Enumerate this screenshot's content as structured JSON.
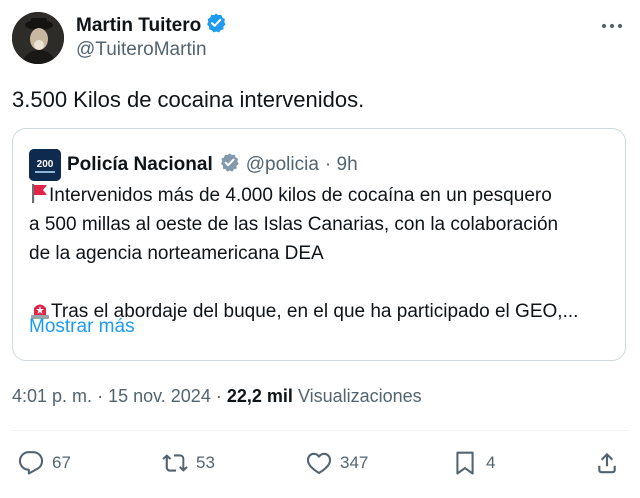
{
  "author": {
    "name": "Martin Tuitero",
    "handle": "@TuiteroMartin",
    "verified_color": "#1d9bf0"
  },
  "tweet": {
    "text": "3.500 Kilos de cocaina intervenidos."
  },
  "quoted": {
    "name": "Policía Nacional",
    "handle": "@policia",
    "time": "· 9h",
    "logo_text": "200",
    "lines": [
      "Intervenidos más de 4.000 kilos de cocaína en un pesquero",
      "a 500 millas al oeste de las Islas Canarias, con la colaboración",
      "de la agencia norteamericana DEA"
    ],
    "line4": "Tras el abordaje del buque, en el que ha participado el GEO,...",
    "show_more": "Mostrar más"
  },
  "meta": {
    "time": "4:01 p. m.",
    "dot1": "·",
    "date": "15 nov. 2024",
    "dot2": "·",
    "views_count": "22,2 mil",
    "views_label": "Visualizaciones"
  },
  "actions": {
    "replies": "67",
    "reposts": "53",
    "likes": "347",
    "bookmarks": "4"
  },
  "colors": {
    "accent": "#1d9bf0",
    "muted": "#536471",
    "border": "#cfd9de",
    "red_flag": "#e0244a"
  },
  "icons": {
    "more": "more-horizontal-icon",
    "reply": "reply-icon",
    "repost": "repost-icon",
    "like": "like-icon",
    "bookmark": "bookmark-icon",
    "share": "share-icon",
    "flag": "red-flag-emoji",
    "siren": "police-light-emoji"
  }
}
